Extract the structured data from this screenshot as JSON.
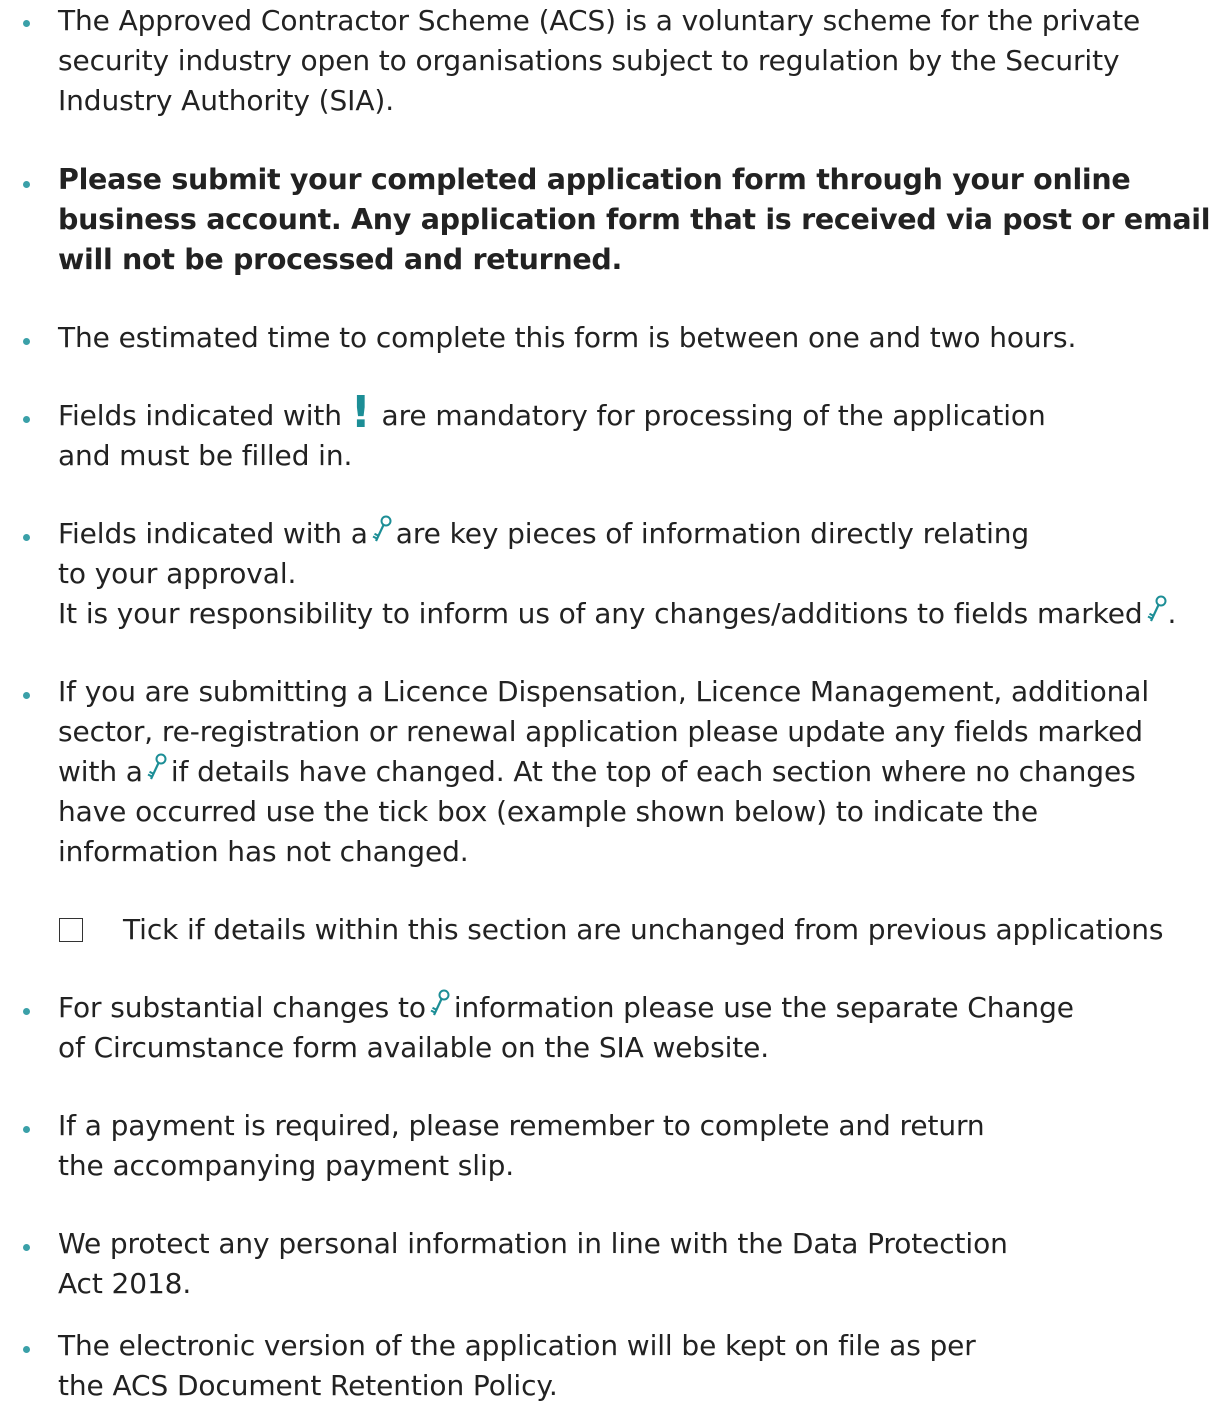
{
  "items": [
    {
      "lines": [
        "The Approved Contractor Scheme (ACS) is a voluntary scheme for the private",
        "security industry open to organisations subject to regulation by the Security",
        "Industry Authority (SIA)."
      ]
    },
    {
      "lines": [
        "Please submit your completed application form through your online",
        "business account. Any application form that is received via post or email",
        "will not be processed and returned."
      ]
    },
    {
      "lines": [
        "The estimated time to complete this form is between one and two hours."
      ]
    },
    {
      "pre": "Fields indicated with",
      "icon": "!",
      "post": "are mandatory for processing of the application",
      "line2": "and must be filled in."
    },
    {
      "pre": "Fields indicated with a",
      "post": "are key pieces of information directly relating",
      "line2": "to your approval.",
      "line3_pre": "It is your responsibility to inform us of any changes/additions to fields marked",
      "line3_post": "."
    },
    {
      "line1": "If you are submitting a Licence Dispensation, Licence Management, additional",
      "line2": "sector, re-registration or renewal application please update any fields marked",
      "line3_pre": "with a",
      "line3_post": "if details have changed. At the top of each section where no changes",
      "line4": "have occurred use the tick box (example shown below) to indicate the",
      "line5": "information has not changed."
    },
    {
      "pre": "For substantial changes to",
      "post": "information please use the separate Change",
      "line2": "of Circumstance form available on the SIA website."
    },
    {
      "lines": [
        "If a payment is required, please remember to complete and return",
        "the accompanying payment slip."
      ]
    },
    {
      "lines": [
        "We protect any personal information in line with the Data Protection",
        "Act 2018."
      ]
    },
    {
      "lines": [
        "The electronic version of the application will be kept on file as per",
        "the ACS Document Retention Policy."
      ]
    }
  ],
  "checkbox": {
    "label": "Tick if details within this section are unchanged from previous applications",
    "checked": false
  },
  "icons": {
    "mandatory": "exclamation-icon",
    "key": "key-icon"
  },
  "colors": {
    "accent": "#1c8e96",
    "bullet": "#3aa0a8",
    "text": "#222222"
  }
}
